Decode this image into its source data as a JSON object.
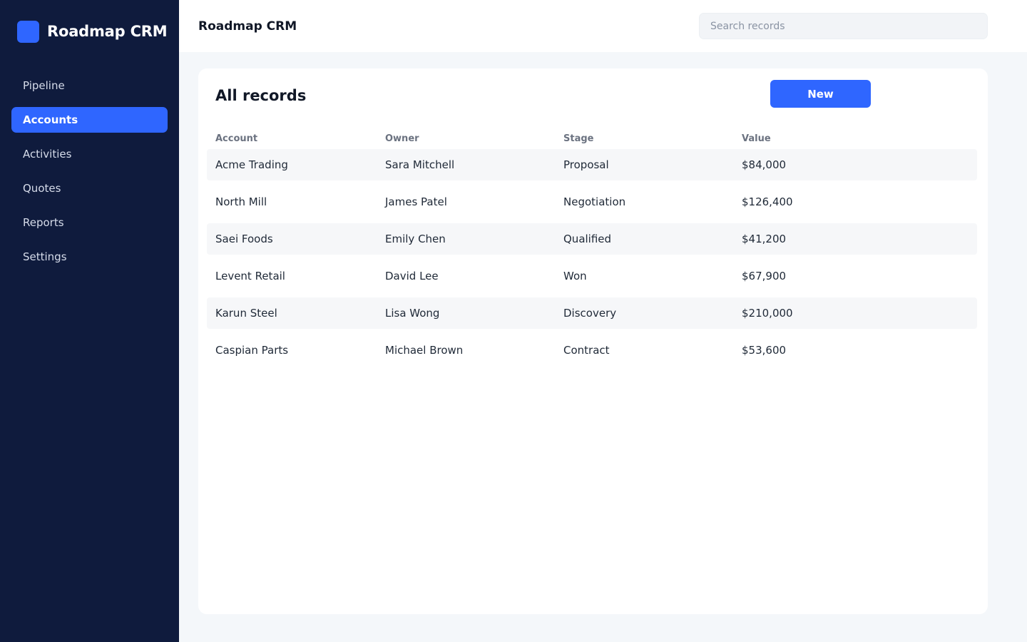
{
  "app": {
    "brand_name": "Roadmap CRM",
    "accent_color": "#2f66ff",
    "sidebar_color": "#0f1b3d"
  },
  "sidebar": {
    "items": [
      {
        "label": "Pipeline",
        "active": false
      },
      {
        "label": "Accounts",
        "active": true
      },
      {
        "label": "Activities",
        "active": false
      },
      {
        "label": "Quotes",
        "active": false
      },
      {
        "label": "Reports",
        "active": false
      },
      {
        "label": "Settings",
        "active": false
      }
    ]
  },
  "header": {
    "title": "Roadmap CRM",
    "search_placeholder": "Search records"
  },
  "main": {
    "title": "All records",
    "new_button_label": "New",
    "table": {
      "columns": [
        "Account",
        "Owner",
        "Stage",
        "Value"
      ],
      "rows": [
        [
          "Acme Trading",
          "Sara Mitchell",
          "Proposal",
          "$84,000"
        ],
        [
          "North Mill",
          "James Patel",
          "Negotiation",
          "$126,400"
        ],
        [
          "Saei Foods",
          "Emily Chen",
          "Qualified",
          "$41,200"
        ],
        [
          "Levent Retail",
          "David Lee",
          "Won",
          "$67,900"
        ],
        [
          "Karun Steel",
          "Lisa Wong",
          "Discovery",
          "$210,000"
        ],
        [
          "Caspian Parts",
          "Michael Brown",
          "Contract",
          "$53,600"
        ]
      ]
    }
  }
}
